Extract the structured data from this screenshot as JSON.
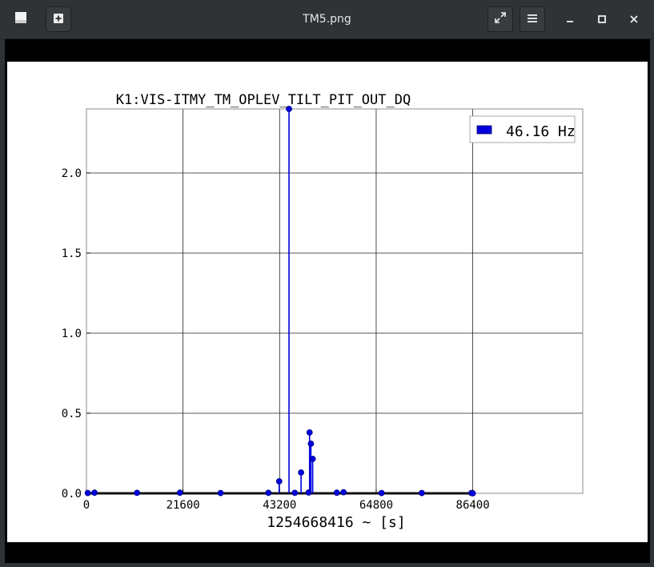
{
  "window": {
    "title": "TM5.png"
  },
  "toolbar": {
    "open_icon": "image-open-icon",
    "new_icon": "new-window-icon",
    "fullscreen_icon": "fullscreen-icon",
    "menu_icon": "hamburger-menu-icon",
    "minimize_icon": "minimize-icon",
    "maximize_icon": "maximize-icon",
    "close_icon": "close-icon"
  },
  "chart_data": {
    "type": "scatter",
    "style": "stem",
    "title": "K1:VIS-ITMY_TM_OPLEV_TILT_PIT_OUT_DQ",
    "xlabel": "1254668416 ~ [s]",
    "ylabel": "",
    "xlim": [
      0,
      111000
    ],
    "ylim": [
      0,
      2.4
    ],
    "xticks": [
      0,
      21600,
      43200,
      64800,
      86400
    ],
    "xtick_labels": [
      "0",
      "21600",
      "43200",
      "64800",
      "86400"
    ],
    "yticks": [
      0.0,
      0.5,
      1.0,
      1.5,
      2.0
    ],
    "ytick_labels": [
      "0.0",
      "0.5",
      "1.0",
      "1.5",
      "2.0"
    ],
    "grid": true,
    "legend": {
      "position": "top-right",
      "entries": [
        "46.16 Hz"
      ]
    },
    "color": "#0000dd",
    "series": [
      {
        "name": "46.16 Hz",
        "x": [
          300,
          1800,
          11300,
          20900,
          30000,
          40700,
          43100,
          45300,
          46600,
          48000,
          49700,
          49900,
          50200,
          50600,
          56000,
          57500,
          66000,
          75000,
          86100,
          86400
        ],
        "y": [
          0.002,
          0.004,
          0.003,
          0.004,
          0.002,
          0.003,
          0.075,
          2.4,
          0.003,
          0.13,
          0.005,
          0.38,
          0.31,
          0.215,
          0.004,
          0.007,
          0.002,
          0.002,
          0.002,
          0.0
        ]
      }
    ]
  }
}
